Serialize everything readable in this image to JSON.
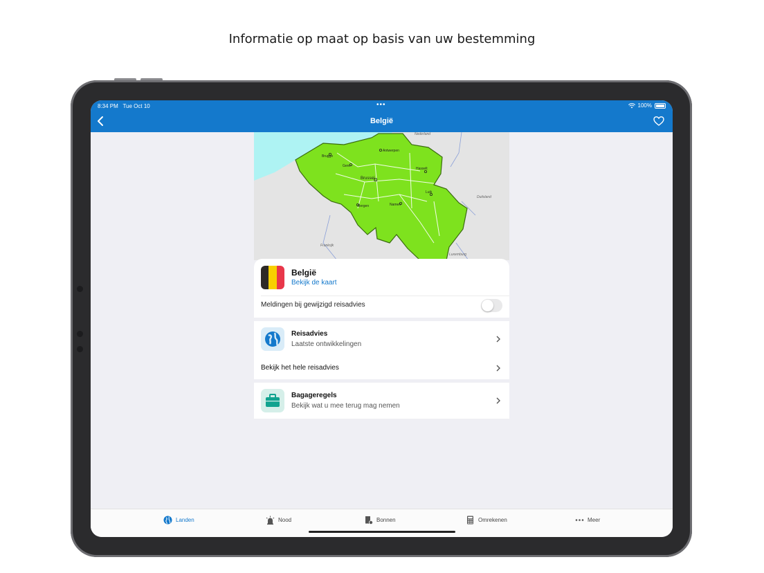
{
  "headline": "Informatie op maat op basis van uw bestemming",
  "status_bar": {
    "time": "8:34 PM",
    "date": "Tue Oct 10",
    "battery": "100%"
  },
  "nav": {
    "title": "België"
  },
  "map": {
    "labels": [
      "Nederland",
      "Antwerpen",
      "Brugge",
      "Gent",
      "Hasselt",
      "Brussel",
      "Luik",
      "Bergen",
      "Namen",
      "Duitsland",
      "Frankrijk",
      "Luxemburg"
    ]
  },
  "country": {
    "name": "België",
    "map_link": "Bekijk de kaart",
    "flag_colors": [
      "#2d2926",
      "#f8d000",
      "#e8374a"
    ]
  },
  "notifications": {
    "label": "Meldingen bij gewijzigd reisadvies",
    "enabled": false
  },
  "reisadvies": {
    "title": "Reisadvies",
    "subtitle": "Laatste ontwikkelingen",
    "full_link": "Bekijk het hele reisadvies"
  },
  "bagage": {
    "title": "Bagageregels",
    "subtitle": "Bekijk wat u mee terug mag nemen"
  },
  "tabs": [
    {
      "label": "Landen",
      "icon": "globe-icon",
      "active": true
    },
    {
      "label": "Nood",
      "icon": "siren-icon",
      "active": false
    },
    {
      "label": "Bonnen",
      "icon": "receipt-icon",
      "active": false
    },
    {
      "label": "Omrekenen",
      "icon": "calculator-icon",
      "active": false
    },
    {
      "label": "Meer",
      "icon": "more-icon",
      "active": false
    }
  ],
  "colors": {
    "accent": "#1479cc",
    "map_country": "#7ee21e",
    "sea": "#aef3f3"
  }
}
